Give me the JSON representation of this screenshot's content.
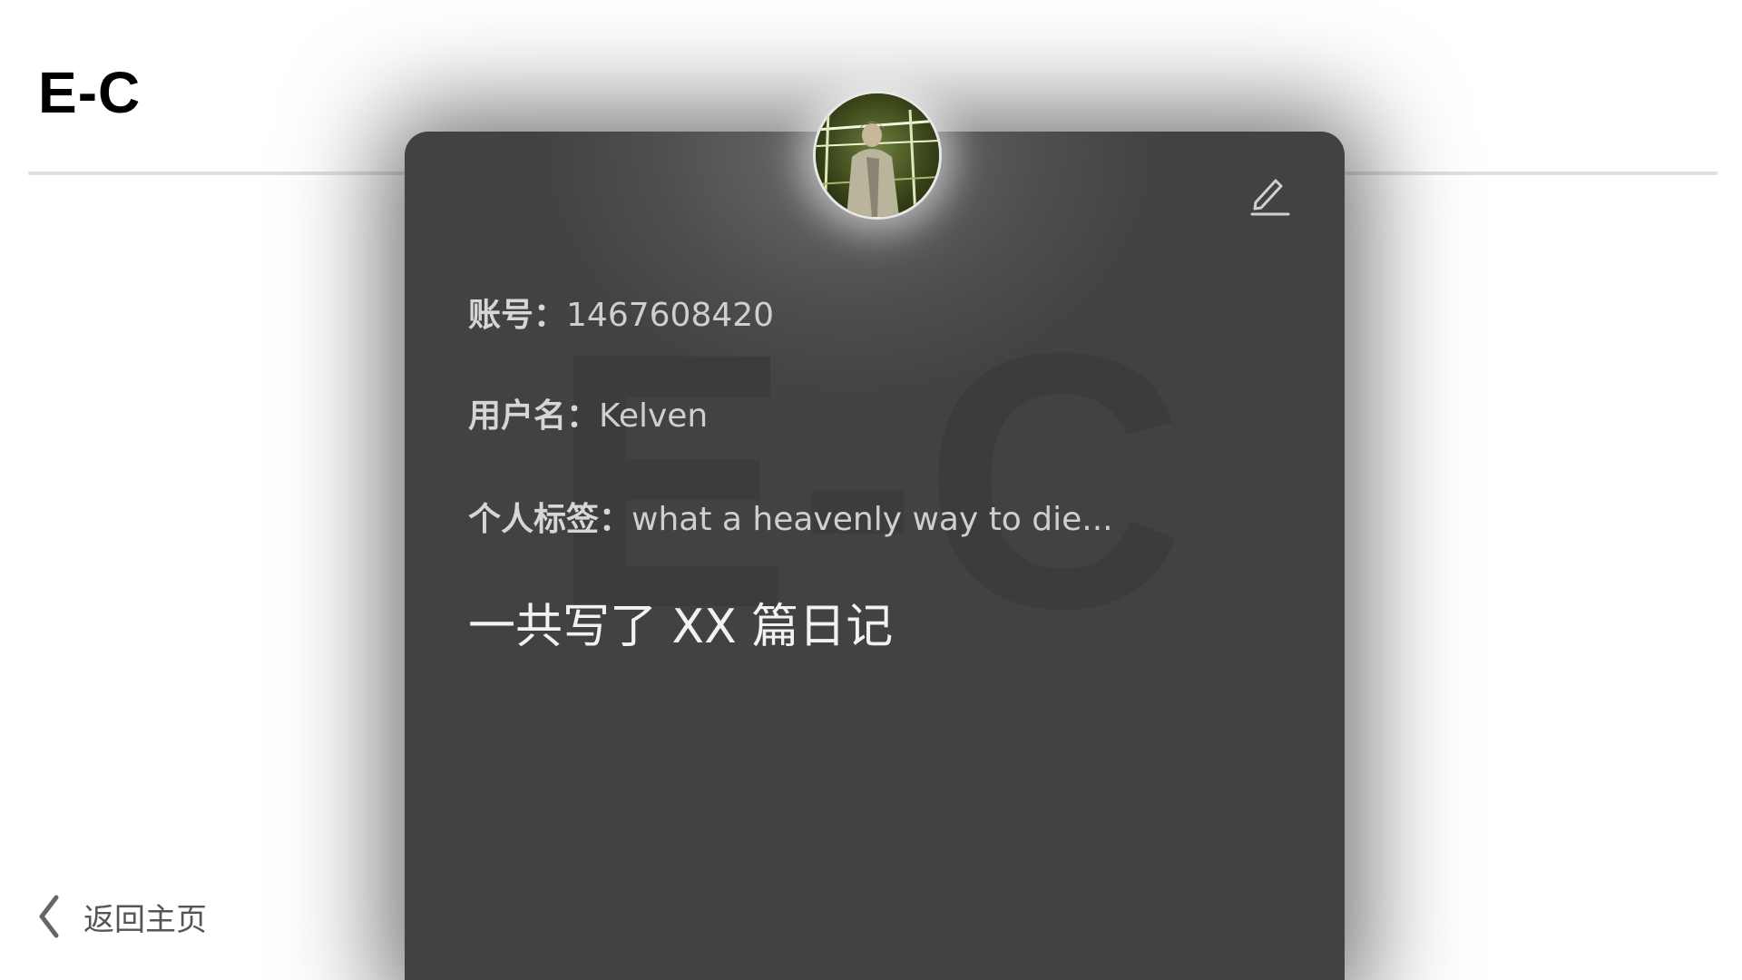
{
  "header": {
    "logo": "E-C"
  },
  "profile": {
    "watermark": "E-C",
    "account_label": "账号：",
    "account_value": "1467608420",
    "username_label": "用户名：",
    "username_value": "Kelven",
    "tag_label": "个人标签：",
    "tag_value": "what a heavenly way to die...",
    "diary_count_text": "一共写了 XX 篇日记",
    "edit_icon": "pencil-icon",
    "avatar_icon": "user-avatar-photo"
  },
  "nav": {
    "back_label": "返回主页",
    "back_icon": "chevron-left-icon"
  },
  "colors": {
    "card_background": "#424242",
    "page_background": "#ffffff",
    "logo": "#000000",
    "text_light": "#cfcfcf"
  }
}
